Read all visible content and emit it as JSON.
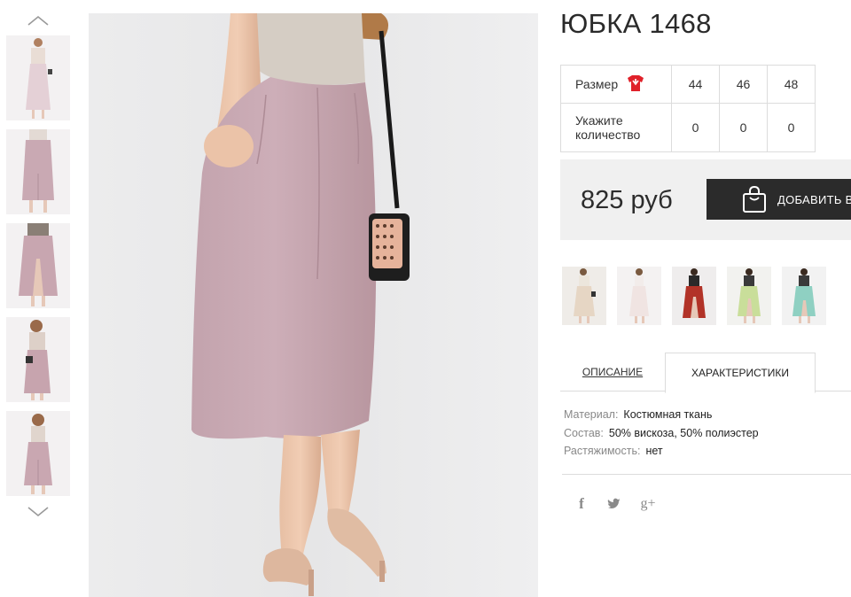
{
  "product": {
    "title": "ЮБКА 1468",
    "price": "825 руб",
    "add_to_cart_label": "ДОБАВИТЬ В"
  },
  "sizes": {
    "size_label": "Размер",
    "quantity_label_line1": "Укажите",
    "quantity_label_line2": "количество",
    "items": [
      {
        "size": "44",
        "qty": "0"
      },
      {
        "size": "46",
        "qty": "0"
      },
      {
        "size": "48",
        "qty": "0"
      }
    ]
  },
  "variants": [
    {
      "color": "#e6d6c4",
      "top": "#ece6dc"
    },
    {
      "color": "#f0e4e2",
      "top": "#f2ecea"
    },
    {
      "color": "#b23328",
      "top": "#2a2a2a"
    },
    {
      "color": "#c9de9a",
      "top": "#3a3a3a"
    },
    {
      "color": "#8fd0c2",
      "top": "#3a3a3a"
    }
  ],
  "tabs": {
    "description": "ОПИСАНИЕ",
    "characteristics": "ХАРАКТЕРИСТИКИ"
  },
  "specs": [
    {
      "key": "Материал:",
      "value": "Костюмная ткань"
    },
    {
      "key": "Состав:",
      "value": "50% вискоза, 50% полиэстер"
    },
    {
      "key": "Растяжимость:",
      "value": "нет"
    }
  ],
  "social": {
    "facebook": "f",
    "google_plus": "g+"
  },
  "colors": {
    "skirt": "#c8a9b3",
    "button_bg": "#2b2b2b",
    "price_bg": "#f0f0f0",
    "size_icon": "#e0212a"
  }
}
